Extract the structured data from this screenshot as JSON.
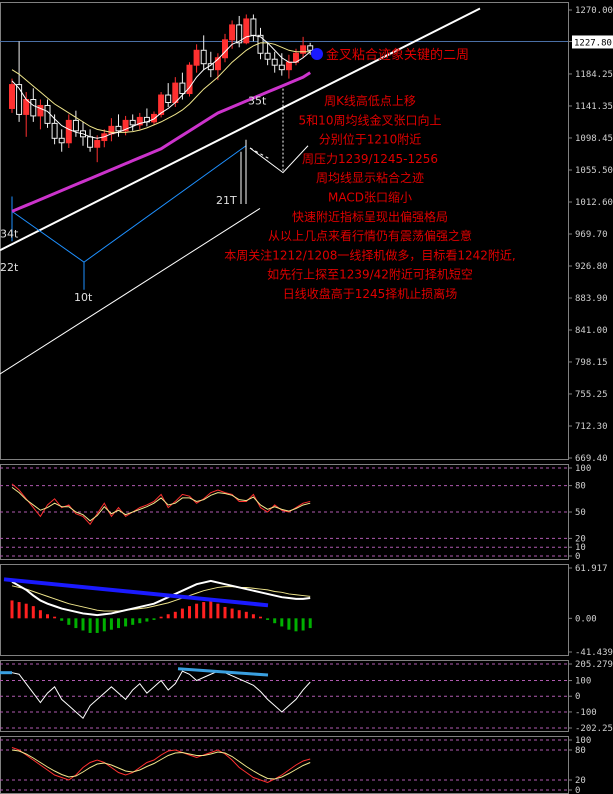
{
  "colors": {
    "background": "#000000",
    "frame": "#808080",
    "up_candle": "#ff3030",
    "down_candle": "#f0f0f0",
    "ma_fast": "#ffffff",
    "ma_mid": "#f0e68c",
    "ma_slow": "#cc33cc",
    "trendline": "#ffffff",
    "wave_line": "#1e90ff",
    "annotation": "#e00000",
    "macd_up": "#ff2020",
    "macd_down": "#00b000",
    "divergence": "#1a1aff",
    "divergence2": "#3aa0e0",
    "price_tag_bg": "#ffffff",
    "price_tag_text": "#000000"
  },
  "chart_data": [
    {
      "type": "candlestick",
      "panel": "price",
      "price_axis_ticks": [
        "1270.00",
        "1227.80",
        "1184.25",
        "1141.35",
        "1098.45",
        "1055.50",
        "1012.60",
        "969.70",
        "926.80",
        "883.90",
        "841.00",
        "798.15",
        "755.25",
        "712.30",
        "669.40"
      ],
      "ylim": [
        669.4,
        1270.0
      ],
      "current_price": "1227.80",
      "wave_labels": [
        "34t",
        "22t",
        "10t",
        "21T",
        "35t"
      ],
      "callout": "金叉粘合迹象关键的二周",
      "notes": [
        "周K线高低点上移",
        "5和10周均线金叉张口向上",
        "分别位于1210附近",
        "周压力1239/1245-1256",
        "周均线显示粘合之迹",
        "MACD张口缩小",
        "快速附近指标呈现出偏强格局",
        "从以上几点来看行情仍有震荡偏强之意",
        "本周关注1212/1208一线择机做多，目标看1242附近,",
        "如先行上探至1239/42附近可择机短空",
        "日线收盘高于1245择机止损离场"
      ],
      "candles": [
        {
          "o": 1138,
          "h": 1178,
          "l": 1132,
          "c": 1170
        },
        {
          "o": 1170,
          "h": 1228,
          "l": 1120,
          "c": 1130
        },
        {
          "o": 1130,
          "h": 1160,
          "l": 1100,
          "c": 1150
        },
        {
          "o": 1150,
          "h": 1165,
          "l": 1120,
          "c": 1128
        },
        {
          "o": 1128,
          "h": 1150,
          "l": 1110,
          "c": 1142
        },
        {
          "o": 1142,
          "h": 1150,
          "l": 1112,
          "c": 1118
        },
        {
          "o": 1118,
          "h": 1130,
          "l": 1090,
          "c": 1098
        },
        {
          "o": 1098,
          "h": 1110,
          "l": 1080,
          "c": 1092
        },
        {
          "o": 1092,
          "h": 1130,
          "l": 1085,
          "c": 1122
        },
        {
          "o": 1122,
          "h": 1135,
          "l": 1100,
          "c": 1108
        },
        {
          "o": 1108,
          "h": 1120,
          "l": 1088,
          "c": 1100
        },
        {
          "o": 1100,
          "h": 1110,
          "l": 1080,
          "c": 1086
        },
        {
          "o": 1086,
          "h": 1102,
          "l": 1066,
          "c": 1095
        },
        {
          "o": 1095,
          "h": 1110,
          "l": 1086,
          "c": 1104
        },
        {
          "o": 1104,
          "h": 1125,
          "l": 1094,
          "c": 1114
        },
        {
          "o": 1114,
          "h": 1130,
          "l": 1100,
          "c": 1108
        },
        {
          "o": 1108,
          "h": 1128,
          "l": 1102,
          "c": 1122
        },
        {
          "o": 1122,
          "h": 1130,
          "l": 1108,
          "c": 1116
        },
        {
          "o": 1116,
          "h": 1132,
          "l": 1110,
          "c": 1126
        },
        {
          "o": 1126,
          "h": 1138,
          "l": 1114,
          "c": 1120
        },
        {
          "o": 1120,
          "h": 1134,
          "l": 1116,
          "c": 1130
        },
        {
          "o": 1130,
          "h": 1160,
          "l": 1126,
          "c": 1156
        },
        {
          "o": 1156,
          "h": 1172,
          "l": 1140,
          "c": 1146
        },
        {
          "o": 1146,
          "h": 1180,
          "l": 1140,
          "c": 1172
        },
        {
          "o": 1172,
          "h": 1186,
          "l": 1150,
          "c": 1158
        },
        {
          "o": 1158,
          "h": 1200,
          "l": 1154,
          "c": 1196
        },
        {
          "o": 1196,
          "h": 1224,
          "l": 1186,
          "c": 1216
        },
        {
          "o": 1216,
          "h": 1236,
          "l": 1190,
          "c": 1198
        },
        {
          "o": 1198,
          "h": 1214,
          "l": 1180,
          "c": 1190
        },
        {
          "o": 1190,
          "h": 1212,
          "l": 1176,
          "c": 1206
        },
        {
          "o": 1206,
          "h": 1238,
          "l": 1200,
          "c": 1230
        },
        {
          "o": 1230,
          "h": 1256,
          "l": 1218,
          "c": 1250
        },
        {
          "o": 1250,
          "h": 1262,
          "l": 1220,
          "c": 1226
        },
        {
          "o": 1226,
          "h": 1264,
          "l": 1224,
          "c": 1258
        },
        {
          "o": 1258,
          "h": 1264,
          "l": 1228,
          "c": 1236
        },
        {
          "o": 1236,
          "h": 1246,
          "l": 1204,
          "c": 1212
        },
        {
          "o": 1212,
          "h": 1226,
          "l": 1196,
          "c": 1204
        },
        {
          "o": 1204,
          "h": 1214,
          "l": 1186,
          "c": 1196
        },
        {
          "o": 1196,
          "h": 1212,
          "l": 1182,
          "c": 1190
        },
        {
          "o": 1190,
          "h": 1210,
          "l": 1178,
          "c": 1200
        },
        {
          "o": 1200,
          "h": 1218,
          "l": 1196,
          "c": 1212
        },
        {
          "o": 1212,
          "h": 1234,
          "l": 1206,
          "c": 1222
        },
        {
          "o": 1222,
          "h": 1226,
          "l": 1210,
          "c": 1216
        }
      ],
      "ma5": [
        1175,
        1165,
        1150,
        1142,
        1138,
        1134,
        1124,
        1115,
        1110,
        1106,
        1104,
        1100,
        1098,
        1100,
        1104,
        1106,
        1110,
        1114,
        1118,
        1120,
        1124,
        1132,
        1138,
        1146,
        1156,
        1166,
        1180,
        1190,
        1196,
        1204,
        1214,
        1224,
        1228,
        1234,
        1236,
        1234,
        1226,
        1216,
        1206,
        1200,
        1200,
        1206,
        1214
      ],
      "ma10": [
        1190,
        1184,
        1176,
        1168,
        1160,
        1152,
        1144,
        1138,
        1132,
        1126,
        1120,
        1114,
        1110,
        1108,
        1106,
        1106,
        1106,
        1107,
        1109,
        1112,
        1116,
        1120,
        1125,
        1130,
        1136,
        1144,
        1154,
        1164,
        1172,
        1180,
        1190,
        1200,
        1208,
        1216,
        1222,
        1226,
        1226,
        1224,
        1220,
        1216,
        1214,
        1214,
        1214
      ],
      "ma30": [
        1000,
        1004,
        1008,
        1012,
        1016,
        1020,
        1024,
        1028,
        1032,
        1036,
        1040,
        1044,
        1048,
        1052,
        1056,
        1060,
        1064,
        1068,
        1072,
        1076,
        1080,
        1084,
        1090,
        1096,
        1102,
        1108,
        1114,
        1120,
        1126,
        1132,
        1136,
        1140,
        1144,
        1148,
        1152,
        1156,
        1160,
        1164,
        1168,
        1172,
        1176,
        1180,
        1186
      ]
    },
    {
      "type": "line",
      "panel": "oscillator-1",
      "axis_ticks": [
        "100",
        "80",
        "50",
        "20",
        "10",
        "0"
      ],
      "ylim": [
        0,
        100
      ],
      "series": [
        {
          "values": [
            82,
            75,
            65,
            55,
            45,
            58,
            65,
            55,
            58,
            48,
            45,
            36,
            48,
            60,
            45,
            55,
            45,
            50,
            55,
            58,
            62,
            70,
            55,
            62,
            70,
            68,
            60,
            65,
            72,
            75,
            72,
            70,
            62,
            62,
            70,
            55,
            50,
            58,
            52,
            50,
            55,
            60,
            62
          ]
        },
        {
          "values": [
            78,
            72,
            64,
            58,
            52,
            55,
            60,
            56,
            56,
            50,
            47,
            40,
            46,
            56,
            48,
            52,
            47,
            50,
            53,
            56,
            60,
            66,
            58,
            60,
            66,
            66,
            62,
            64,
            69,
            72,
            71,
            69,
            64,
            63,
            67,
            58,
            53,
            56,
            53,
            51,
            54,
            58,
            60
          ]
        }
      ]
    },
    {
      "type": "bar",
      "panel": "macd",
      "axis_ticks": [
        "61.917",
        "0.00",
        "-41.439"
      ],
      "ylim": [
        -41.439,
        61.917
      ],
      "histogram": [
        22,
        20,
        18,
        15,
        10,
        5,
        2,
        -3,
        -8,
        -12,
        -15,
        -18,
        -18,
        -16,
        -14,
        -12,
        -10,
        -8,
        -6,
        -4,
        -2,
        2,
        5,
        8,
        12,
        15,
        18,
        20,
        22,
        18,
        14,
        12,
        10,
        8,
        5,
        2,
        -2,
        -6,
        -10,
        -14,
        -16,
        -15,
        -12
      ],
      "dif": [
        45,
        40,
        35,
        28,
        22,
        18,
        15,
        12,
        10,
        8,
        6,
        5,
        4,
        5,
        6,
        8,
        10,
        12,
        14,
        16,
        18,
        22,
        26,
        30,
        34,
        38,
        42,
        44,
        46,
        44,
        42,
        40,
        38,
        36,
        34,
        32,
        30,
        28,
        26,
        25,
        24,
        24,
        25
      ],
      "dea": [
        40,
        38,
        36,
        33,
        30,
        27,
        24,
        21,
        18,
        16,
        14,
        12,
        10,
        9,
        9,
        9,
        10,
        11,
        12,
        13,
        15,
        17,
        19,
        22,
        25,
        28,
        31,
        34,
        36,
        38,
        39,
        39,
        38,
        38,
        37,
        36,
        35,
        33,
        32,
        30,
        29,
        28,
        27
      ]
    },
    {
      "type": "line",
      "panel": "cci",
      "axis_ticks": [
        "205.2792",
        "100",
        "0",
        "-100",
        "-202.254"
      ],
      "ylim": [
        -202.254,
        205.2792
      ],
      "series": [
        {
          "values": [
            150,
            140,
            80,
            20,
            -40,
            20,
            60,
            -20,
            -60,
            -100,
            -140,
            -60,
            -20,
            20,
            60,
            20,
            -20,
            40,
            80,
            20,
            60,
            100,
            40,
            80,
            160,
            140,
            100,
            120,
            140,
            160,
            150,
            130,
            110,
            90,
            70,
            30,
            -20,
            -60,
            -100,
            -60,
            -20,
            40,
            90
          ]
        }
      ]
    },
    {
      "type": "line",
      "panel": "oscillator-2",
      "axis_ticks": [
        "100",
        "80",
        "20",
        "0"
      ],
      "ylim": [
        0,
        100
      ],
      "series": [
        {
          "values": [
            85,
            80,
            70,
            60,
            50,
            40,
            30,
            25,
            20,
            30,
            45,
            55,
            60,
            55,
            45,
            35,
            30,
            35,
            45,
            55,
            60,
            70,
            78,
            80,
            75,
            70,
            65,
            70,
            75,
            80,
            72,
            60,
            45,
            35,
            25,
            20,
            15,
            22,
            30,
            40,
            50,
            58,
            62
          ]
        },
        {
          "values": [
            80,
            78,
            72,
            64,
            55,
            46,
            38,
            31,
            26,
            28,
            36,
            45,
            52,
            54,
            50,
            44,
            38,
            36,
            40,
            47,
            53,
            61,
            69,
            74,
            75,
            72,
            69,
            69,
            72,
            76,
            74,
            67,
            57,
            47,
            38,
            30,
            23,
            22,
            26,
            33,
            41,
            49,
            55
          ]
        }
      ]
    }
  ]
}
